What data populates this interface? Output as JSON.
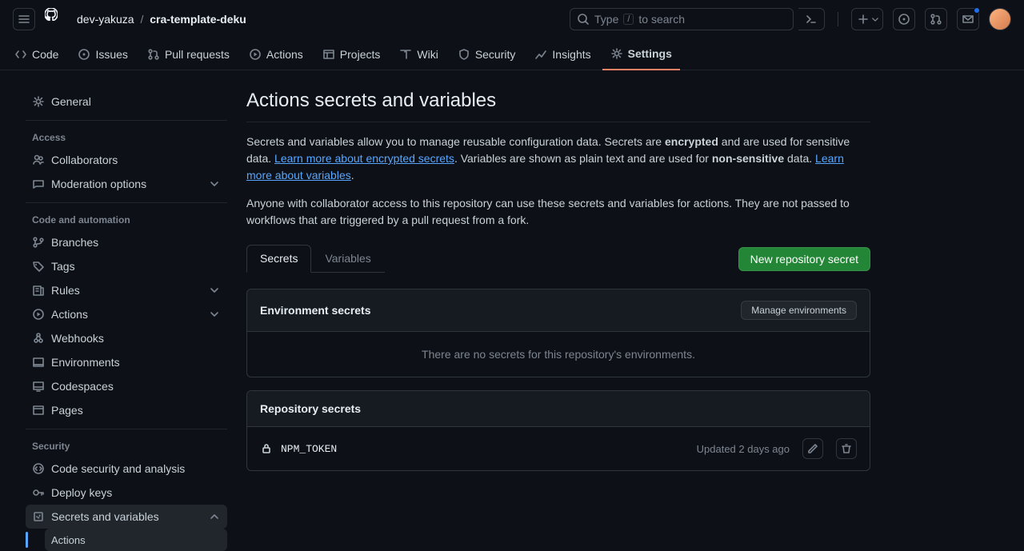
{
  "header": {
    "owner": "dev-yakuza",
    "repo": "cra-template-deku",
    "search_prefix": "Type",
    "search_key": "/",
    "search_suffix": "to search"
  },
  "nav": {
    "code": "Code",
    "issues": "Issues",
    "pulls": "Pull requests",
    "actions": "Actions",
    "projects": "Projects",
    "wiki": "Wiki",
    "security": "Security",
    "insights": "Insights",
    "settings": "Settings"
  },
  "sidebar": {
    "general": "General",
    "access_hdr": "Access",
    "collaborators": "Collaborators",
    "moderation": "Moderation options",
    "code_hdr": "Code and automation",
    "branches": "Branches",
    "tags": "Tags",
    "rules": "Rules",
    "actions": "Actions",
    "webhooks": "Webhooks",
    "environments": "Environments",
    "codespaces": "Codespaces",
    "pages": "Pages",
    "security_hdr": "Security",
    "code_security": "Code security and analysis",
    "deploy_keys": "Deploy keys",
    "secrets_vars": "Secrets and variables",
    "sub_actions": "Actions"
  },
  "main": {
    "title": "Actions secrets and variables",
    "desc1_a": "Secrets and variables allow you to manage reusable configuration data. Secrets are ",
    "desc1_b": "encrypted",
    "desc1_c": " and are used for sensitive data. ",
    "link1": "Learn more about encrypted secrets",
    "desc1_d": ". Variables are shown as plain text and are used for ",
    "desc1_e": "non-sensitive",
    "desc1_f": " data. ",
    "link2": "Learn more about variables",
    "desc1_g": ".",
    "desc2": "Anyone with collaborator access to this repository can use these secrets and variables for actions. They are not passed to workflows that are triggered by a pull request from a fork.",
    "tab_secrets": "Secrets",
    "tab_vars": "Variables",
    "new_secret": "New repository secret",
    "env_title": "Environment secrets",
    "manage_env": "Manage environments",
    "env_empty": "There are no secrets for this repository's environments.",
    "repo_title": "Repository secrets",
    "secret_name": "NPM_TOKEN",
    "secret_meta": "Updated 2 days ago"
  }
}
